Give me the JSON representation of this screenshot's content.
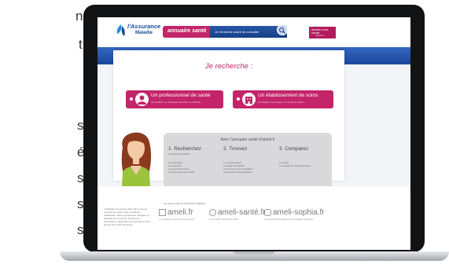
{
  "left_text_fragments": [
    {
      "id": "frag-1",
      "text": "n"
    },
    {
      "id": "frag-2",
      "text": "t"
    },
    {
      "id": "frag-3",
      "text": "s"
    },
    {
      "id": "frag-4",
      "text": "é"
    },
    {
      "id": "frag-5",
      "text": "s"
    },
    {
      "id": "frag-6",
      "text": "s"
    },
    {
      "id": "frag-7",
      "text": "s"
    }
  ],
  "header": {
    "logo_main": "l'Assurance",
    "logo_sub": "Maladie",
    "annuaire_tab": "annuaire santé",
    "search_prompt": "Je m'informe avant de consulter",
    "account_label": "Accéder à mon compte",
    "account_sub": "ameli.fr"
  },
  "main": {
    "heading": "Je recherche :",
    "cta_pro": {
      "title": "Un professionnel de santé",
      "sub": "Un médecin, un chirurgien-dentiste, un infirmier..."
    },
    "cta_etab": {
      "title": "Un établissement de soins",
      "sub": "Un hôpital, une clinique, un centre de santé..."
    }
  },
  "info_panel": {
    "title": "Avec l'annuaire santé d'ameli.fr",
    "steps": [
      {
        "title": "1. Recherchez",
        "subtitle": "sur plusieurs critères",
        "items": [
          "La profession",
          "La proximité",
          "Le type d'honoraires",
          "L'équipement carte Vitale"
        ]
      },
      {
        "title": "2. Trouvez",
        "subtitle": "",
        "items": [
          "Les coordonnées",
          "Le détail de l'activité",
          "Les horaires de consultation",
          "Les durées d'hospitalisation"
        ]
      },
      {
        "title": "3. Comparez",
        "subtitle": "",
        "items": [
          "Les tarifs",
          "Les bases de remboursement"
        ]
      }
    ]
  },
  "footer": {
    "disclaimer": "L'utilisation du service offert par le site est soumise au respect des conditions d'utilisation. Toute reproduction intégrale ou partielle des contenus, données et informations disponibles est interdite et peut donner lieu à des sanctions.",
    "label": "Les autres sites de l'Assurance Maladie",
    "brands": [
      {
        "name": "ameli.fr",
        "desc": "Le site dédié aux assurés et à leur santé"
      },
      {
        "name": "ameli-santé.fr",
        "desc": "Le site dédié à l'information santé"
      },
      {
        "name": "ameli-sophia.fr",
        "desc": "Le service d'accompagnement des maladies chroniques"
      }
    ]
  },
  "colors": {
    "accent_pink": "#c4246a",
    "header_blue": "#1b469a",
    "panel_grey": "#d9d9db"
  }
}
